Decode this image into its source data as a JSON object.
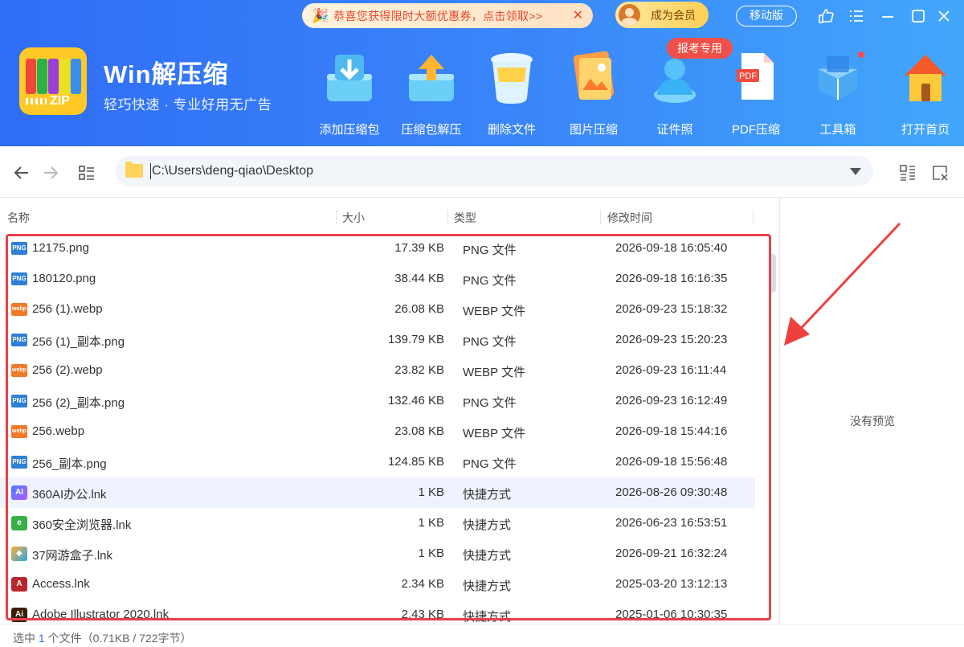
{
  "header": {
    "promo": {
      "text": "恭喜您获得限时大额优惠券，点击领取>>",
      "close": "✕"
    },
    "vip_label": "成为会员",
    "mobile_label": "移动版",
    "brand_name": "Win解压缩",
    "slogan": "轻巧快速 · 专业好用无广告",
    "logo_text": "ZIP",
    "exam_badge": "报考专用",
    "tools": [
      {
        "label": "添加压缩包",
        "icon": "add-archive-icon"
      },
      {
        "label": "压缩包解压",
        "icon": "extract-archive-icon"
      },
      {
        "label": "删除文件",
        "icon": "delete-file-icon"
      },
      {
        "label": "图片压缩",
        "icon": "image-compress-icon"
      },
      {
        "label": "证件照",
        "icon": "id-photo-icon"
      },
      {
        "label": "PDF压缩",
        "icon": "pdf-compress-icon"
      },
      {
        "label": "工具箱",
        "icon": "toolbox-icon"
      },
      {
        "label": "打开首页",
        "icon": "home-icon"
      }
    ]
  },
  "nav": {
    "path": "C:\\Users\\deng-qiao\\Desktop"
  },
  "list": {
    "columns": {
      "name": "名称",
      "size": "大小",
      "type": "类型",
      "modified": "修改时间"
    },
    "rows": [
      {
        "name": "12175.png",
        "size": "17.39 KB",
        "type": "PNG 文件",
        "date": "2026-09-18 16:05:40",
        "icon": "png"
      },
      {
        "name": "180120.png",
        "size": "38.44 KB",
        "type": "PNG 文件",
        "date": "2026-09-18 16:16:35",
        "icon": "png"
      },
      {
        "name": "256 (1).webp",
        "size": "26.08 KB",
        "type": "WEBP 文件",
        "date": "2026-09-23 15:18:32",
        "icon": "webp"
      },
      {
        "name": "256 (1)_副本.png",
        "size": "139.79 KB",
        "type": "PNG 文件",
        "date": "2026-09-23 15:20:23",
        "icon": "png"
      },
      {
        "name": "256 (2).webp",
        "size": "23.82 KB",
        "type": "WEBP 文件",
        "date": "2026-09-23 16:11:44",
        "icon": "webp"
      },
      {
        "name": "256 (2)_副本.png",
        "size": "132.46 KB",
        "type": "PNG 文件",
        "date": "2026-09-23 16:12:49",
        "icon": "png"
      },
      {
        "name": "256.webp",
        "size": "23.08 KB",
        "type": "WEBP 文件",
        "date": "2026-09-18 15:44:16",
        "icon": "webp"
      },
      {
        "name": "256_副本.png",
        "size": "124.85 KB",
        "type": "PNG 文件",
        "date": "2026-09-18 15:56:48",
        "icon": "png"
      },
      {
        "name": "360AI办公.lnk",
        "size": "1 KB",
        "type": "快捷方式",
        "date": "2026-08-26 09:30:48",
        "icon": "ai"
      },
      {
        "name": "360安全浏览器.lnk",
        "size": "1 KB",
        "type": "快捷方式",
        "date": "2026-06-23 16:53:51",
        "icon": "browser"
      },
      {
        "name": "37网游盒子.lnk",
        "size": "1 KB",
        "type": "快捷方式",
        "date": "2026-09-21 16:32:24",
        "icon": "box"
      },
      {
        "name": "Access.lnk",
        "size": "2.34 KB",
        "type": "快捷方式",
        "date": "2025-03-20 13:12:13",
        "icon": "access"
      },
      {
        "name": "Adobe Illustrator 2020.lnk",
        "size": "2.43 KB",
        "type": "快捷方式",
        "date": "2025-01-06 10:30:35",
        "icon": "ai-adobe"
      }
    ],
    "selected_index": 8
  },
  "preview": {
    "empty_text": "没有预览"
  },
  "status": {
    "prefix": "选中",
    "count": "1",
    "suffix": "个文件（0.71KB / 722字节）"
  },
  "colors": {
    "header_start": "#2f6df6",
    "header_end": "#42a7fb",
    "highlight": "#e8404a",
    "selected_row": "#eef3fd"
  }
}
